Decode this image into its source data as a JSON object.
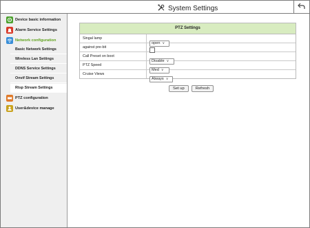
{
  "header": {
    "title": "System Settings",
    "tools_icon": "tools-icon",
    "back_icon": "back-arrow-icon"
  },
  "sidebar": {
    "items": [
      {
        "label": "Device basic information",
        "icon": "device-info-icon",
        "color": "#4aa02c"
      },
      {
        "label": "Alarm Service Settings",
        "icon": "alarm-icon",
        "color": "#d83a2a"
      },
      {
        "label": "Network configuration",
        "icon": "network-icon",
        "color": "#3a8fd8"
      },
      {
        "label": "PTZ configuration",
        "icon": "ptz-icon",
        "color": "#e07a2a"
      },
      {
        "label": "User&device manage",
        "icon": "user-manage-icon",
        "color": "#c9a21d"
      }
    ],
    "network_sub": [
      "Basic Network Settings",
      "Wireless Lan Settings",
      "DDNS Service Settings",
      "Onvif Stream Settings",
      "Rtsp Stream Settings"
    ]
  },
  "ptz": {
    "title": "PTZ Settings",
    "rows": [
      {
        "label": "Singal lamp",
        "value": "open",
        "type": "select"
      },
      {
        "label": "against pre-bit",
        "value": "",
        "type": "checkbox"
      },
      {
        "label": "Call Preset on boot",
        "value": "Disable",
        "type": "select"
      },
      {
        "label": "PTZ Speed",
        "value": "Med",
        "type": "select"
      },
      {
        "label": "Cruise Views",
        "value": "Always",
        "type": "select"
      }
    ],
    "setup_label": "Set up",
    "refresh_label": "Refresh"
  },
  "colors": {
    "accent_green": "#5fa21d",
    "panel_header": "#d8ecc0"
  }
}
